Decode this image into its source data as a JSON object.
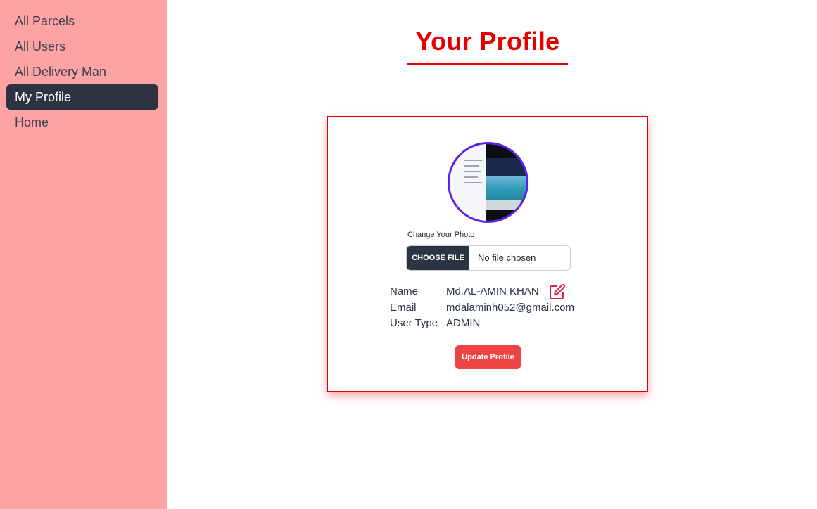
{
  "sidebar": {
    "items": [
      {
        "label": "All Parcels",
        "active": false
      },
      {
        "label": "All Users",
        "active": false
      },
      {
        "label": "All Delivery Man",
        "active": false
      },
      {
        "label": "My Profile",
        "active": true
      },
      {
        "label": "Home",
        "active": false
      }
    ]
  },
  "main": {
    "title": "Your Profile"
  },
  "profile": {
    "change_photo_label": "Change Your Photo",
    "choose_file_label": "CHOOSE FILE",
    "file_status": "No file chosen",
    "fields": {
      "name_label": "Name",
      "name_value": "Md.AL-AMIN KHAN",
      "email_label": "Email",
      "email_value": "mdalaminh052@gmail.com",
      "user_type_label": "User Type",
      "user_type_value": "ADMIN"
    },
    "update_button": "Update Profile"
  },
  "icons": {
    "edit": "edit-icon"
  },
  "colors": {
    "sidebar_bg": "#fea3a3",
    "accent_red": "#e50000",
    "button_red": "#ef4444",
    "dark": "#2b3440",
    "avatar_ring": "#5b21e6"
  }
}
